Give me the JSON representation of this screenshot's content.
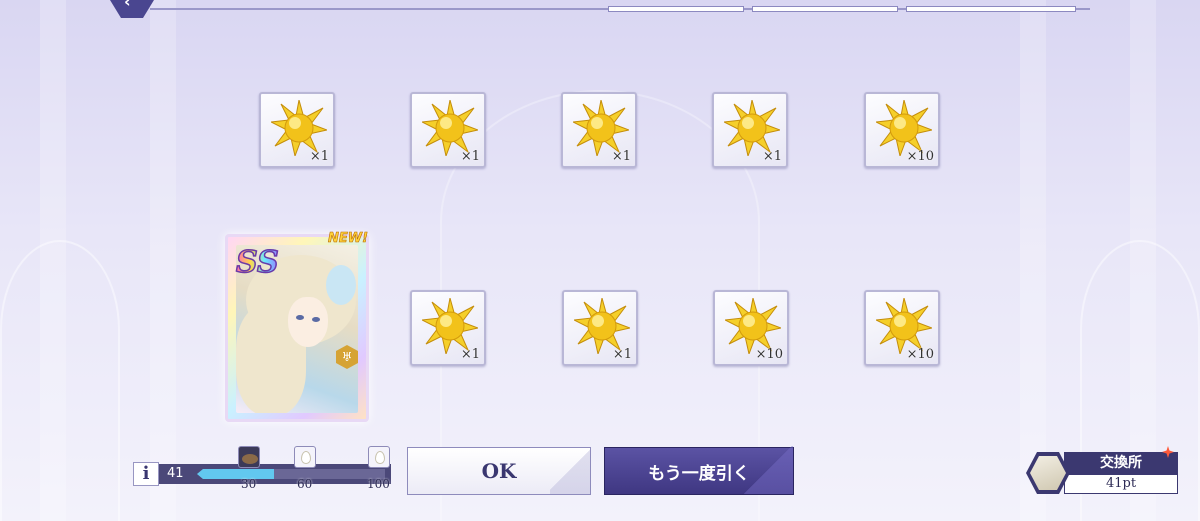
{
  "rewards": {
    "row1": [
      {
        "qty": "×1"
      },
      {
        "qty": "×1"
      },
      {
        "qty": "×1"
      },
      {
        "qty": "×1"
      },
      {
        "qty": "×10"
      }
    ],
    "row2": [
      {
        "qty": "×1"
      },
      {
        "qty": "×1"
      },
      {
        "qty": "×10"
      },
      {
        "qty": "×10"
      }
    ],
    "item_icon": "gold-crystal-icon"
  },
  "character_card": {
    "rank": "SS",
    "new_tag": "NEW!",
    "class_icon": "class-badge-icon"
  },
  "progress": {
    "count": "41",
    "fill_fraction": 0.41,
    "milestones": [
      "30",
      "60",
      "100"
    ]
  },
  "buttons": {
    "ok": "OK",
    "pull_again": "もう一度引く"
  },
  "exchange": {
    "title": "交換所",
    "points": "41pt"
  },
  "colors": {
    "accent": "#3b3870",
    "progress_fill": "#62c8ef",
    "gem_gold": "#f2c21a"
  }
}
